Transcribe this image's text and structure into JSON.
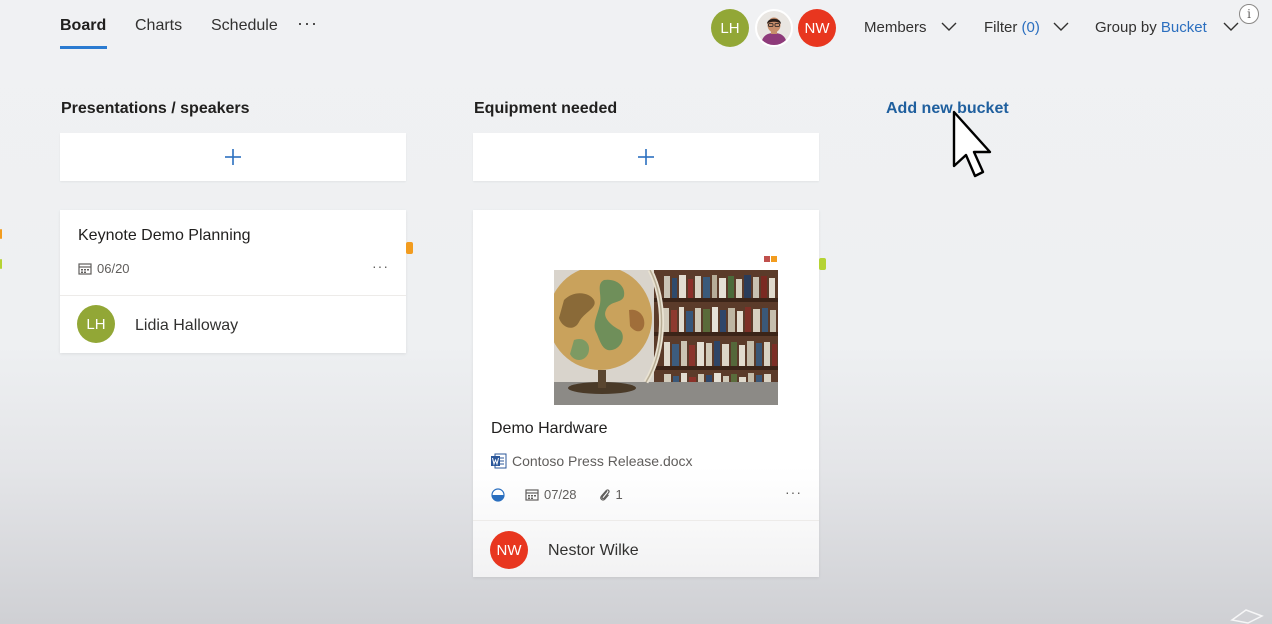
{
  "nav": {
    "tabs": [
      {
        "label": "Board",
        "active": true
      },
      {
        "label": "Charts",
        "active": false
      },
      {
        "label": "Schedule",
        "active": false
      }
    ],
    "more": "···",
    "members_avatars": [
      {
        "initials": "LH",
        "color": "#92a736"
      },
      {
        "initials": "",
        "type": "photo"
      },
      {
        "initials": "NW",
        "color": "#e8361f"
      }
    ],
    "members_label": "Members",
    "filter_label": "Filter",
    "filter_count": "(0)",
    "group_by_label": "Group by",
    "group_by_value": "Bucket",
    "info": "i"
  },
  "buckets": [
    {
      "title": "Presentations / speakers",
      "add_task": "+",
      "tasks": [
        {
          "title": "Keynote Demo Planning",
          "due": "06/20",
          "more": "···",
          "label_color": "#f29c1f",
          "assignee": {
            "initials": "LH",
            "name": "Lidia Halloway",
            "color": "#92a736"
          }
        }
      ]
    },
    {
      "title": "Equipment needed",
      "add_task": "+",
      "tasks": [
        {
          "title": "Demo Hardware",
          "attachment_name": "Contoso Press Release.docx",
          "due": "07/28",
          "attachments_count": "1",
          "more": "···",
          "label_colors": [
            "#c0504d",
            "#f29c1f"
          ],
          "side_label_color": "#b5d334",
          "assignee": {
            "initials": "NW",
            "name": "Nestor Wilke",
            "color": "#e8361f"
          }
        }
      ]
    }
  ],
  "add_new_bucket": "Add new bucket",
  "colors": {
    "accent": "#2b7bd1",
    "link": "#1f5f9e",
    "word_blue": "#2b579a"
  }
}
